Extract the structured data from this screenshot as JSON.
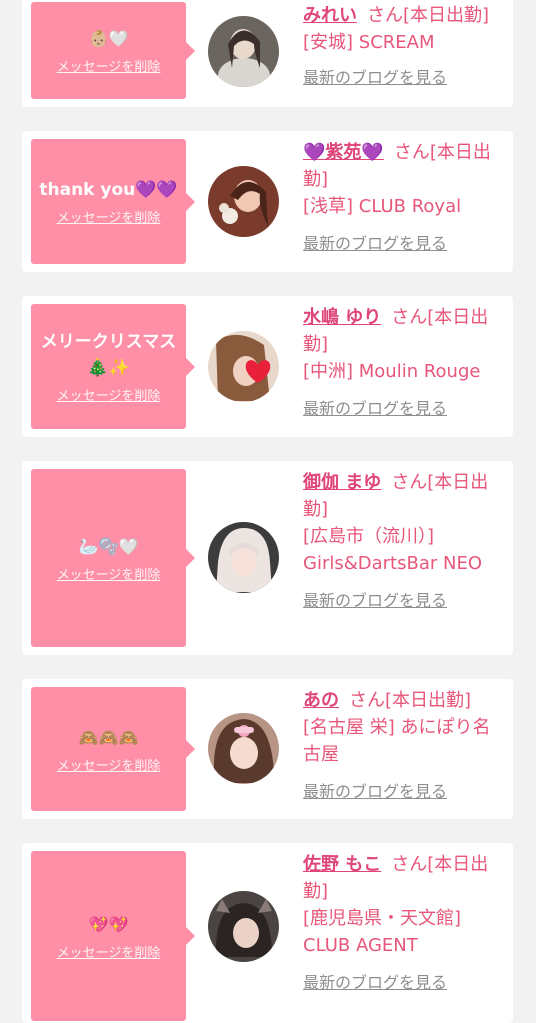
{
  "delete_label": "メッセージを削除",
  "san_suffix": "さん",
  "blog_label": "最新のブログを見る",
  "cards": [
    {
      "message": "👶🏼🤍",
      "name": "みれい",
      "status": "[本日出勤]",
      "shop": "[安城] SCREAM"
    },
    {
      "message": "thank you💜💜",
      "name": "💜紫苑💜",
      "status": "[本日出勤]",
      "shop": "[浅草] CLUB Royal"
    },
    {
      "message": "メリークリスマス🎄✨",
      "name": "水嶋 ゆり",
      "status": "[本日出勤]",
      "shop": "[中洲] Moulin Rouge"
    },
    {
      "message": "🦢🫧🤍",
      "name": "御伽 まゆ",
      "status": "[本日出勤]",
      "shop": "[広島市（流川）] Girls&DartsBar NEO"
    },
    {
      "message": "🙈🙈🙈",
      "name": "あの",
      "status": "[本日出勤]",
      "shop": "[名古屋 栄] あにぽり名古屋"
    },
    {
      "message": "💖💖",
      "name": "佐野 もこ",
      "status": "[本日出勤]",
      "shop": "[鹿児島県・天文館] CLUB AGENT"
    }
  ],
  "colors": {
    "bubble": "#ff8fa6",
    "accent": "#e0457a",
    "muted": "#8e8e8e"
  }
}
